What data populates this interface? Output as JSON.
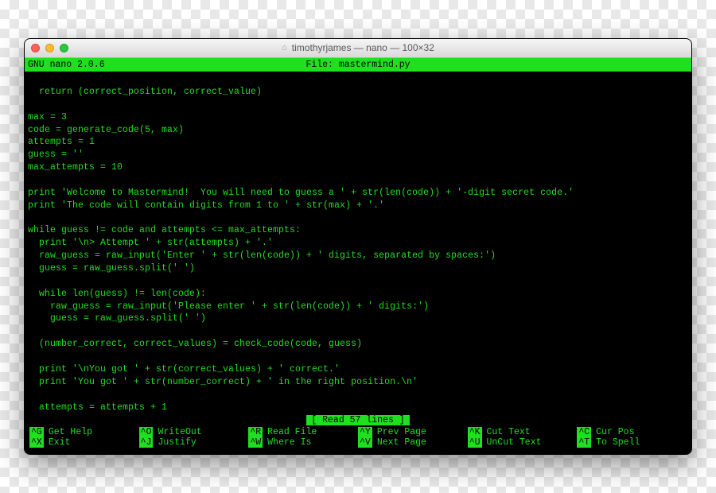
{
  "window": {
    "title": "timothyrjames — nano — 100×32"
  },
  "nano": {
    "version": "GNU nano 2.0.6",
    "file_label": "File: mastermind.py"
  },
  "code": "\n  return (correct_position, correct_value)\n\nmax = 3\ncode = generate_code(5, max)\nattempts = 1\nguess = ''\nmax_attempts = 10\n\nprint 'Welcome to Mastermind!  You will need to guess a ' + str(len(code)) + '-digit secret code.'\nprint 'The code will contain digits from 1 to ' + str(max) + '.'\n\nwhile guess != code and attempts <= max_attempts:\n  print '\\n> Attempt ' + str(attempts) + '.'\n  raw_guess = raw_input('Enter ' + str(len(code)) + ' digits, separated by spaces:')\n  guess = raw_guess.split(' ')\n\n  while len(guess) != len(code):\n    raw_guess = raw_input('Please enter ' + str(len(code)) + ' digits:')\n    guess = raw_guess.split(' ')\n\n  (number_correct, correct_values) = check_code(code, guess)\n\n  print '\\nYou got ' + str(correct_values) + ' correct.'\n  print 'You got ' + str(number_correct) + ' in the right position.\\n'\n\n  attempts = attempts + 1\n",
  "status": "[ Read 57 lines ]",
  "shortcuts": {
    "row1": [
      {
        "key": "^G",
        "label": "Get Help"
      },
      {
        "key": "^O",
        "label": "WriteOut"
      },
      {
        "key": "^R",
        "label": "Read File"
      },
      {
        "key": "^Y",
        "label": "Prev Page"
      },
      {
        "key": "^K",
        "label": "Cut Text"
      },
      {
        "key": "^C",
        "label": "Cur Pos"
      }
    ],
    "row2": [
      {
        "key": "^X",
        "label": "Exit"
      },
      {
        "key": "^J",
        "label": "Justify"
      },
      {
        "key": "^W",
        "label": "Where Is"
      },
      {
        "key": "^V",
        "label": "Next Page"
      },
      {
        "key": "^U",
        "label": "UnCut Text"
      },
      {
        "key": "^T",
        "label": "To Spell"
      }
    ]
  }
}
